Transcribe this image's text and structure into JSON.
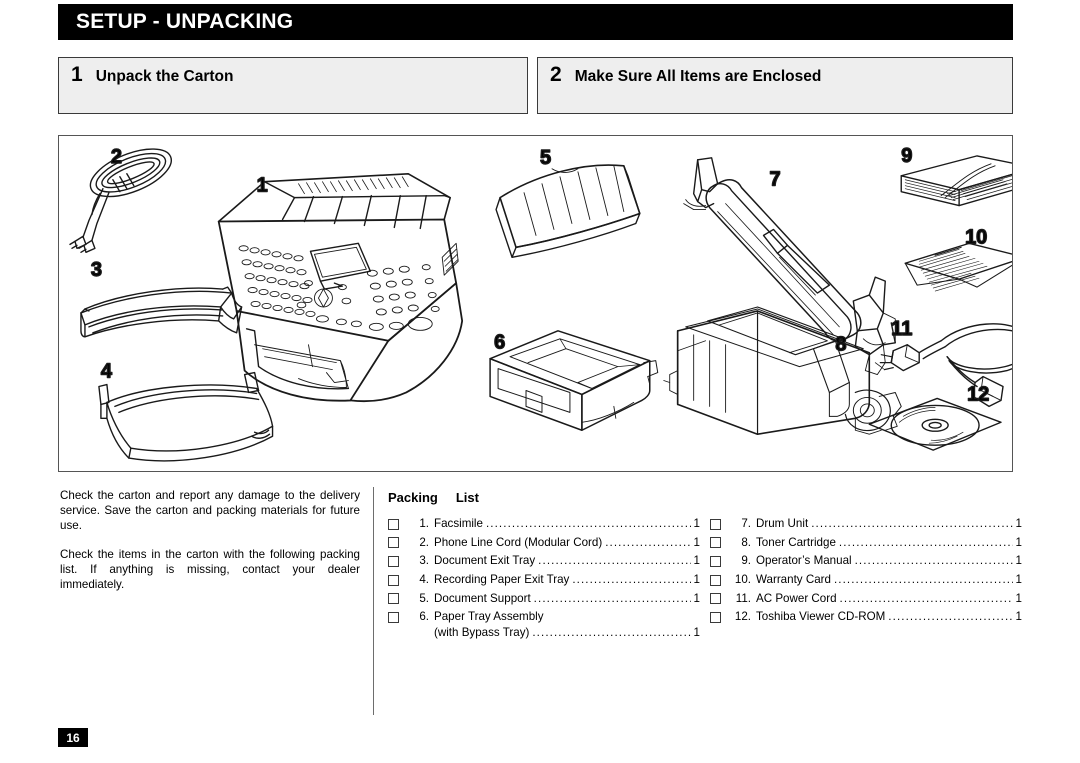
{
  "header": {
    "title": "SETUP - UNPACKING"
  },
  "steps": [
    {
      "number": "1",
      "label": "Unpack the Carton"
    },
    {
      "number": "2",
      "label": "Make Sure All Items are Enclosed"
    }
  ],
  "illustration": {
    "callouts": [
      {
        "id": "1",
        "label": "Facsimile"
      },
      {
        "id": "2",
        "label": "Phone Line Cord"
      },
      {
        "id": "3",
        "label": "Document Exit Tray"
      },
      {
        "id": "4",
        "label": "Recording Paper Exit Tray"
      },
      {
        "id": "5",
        "label": "Document Support"
      },
      {
        "id": "6",
        "label": "Paper Tray Assembly"
      },
      {
        "id": "7",
        "label": "Drum Unit"
      },
      {
        "id": "8",
        "label": "Toner Cartridge"
      },
      {
        "id": "9",
        "label": "Operator's Manual"
      },
      {
        "id": "10",
        "label": "Warranty Card"
      },
      {
        "id": "11",
        "label": "AC Power Cord"
      },
      {
        "id": "12",
        "label": "Toshiba Viewer CD-ROM"
      }
    ]
  },
  "instructions": {
    "paragraph1": "Check the carton and report any damage to the delivery service. Save the carton and packing materials for future use.",
    "paragraph2": "Check the items in the carton with the following packing list. If anything is missing, contact your dealer immediately."
  },
  "packing_list": {
    "title_word1": "Packing",
    "title_word2": "List",
    "left_column": [
      {
        "index": "1.",
        "name": "Facsimile",
        "qty": "1"
      },
      {
        "index": "2.",
        "name": "Phone Line Cord (Modular Cord)",
        "qty": "1"
      },
      {
        "index": "3.",
        "name": "Document Exit Tray",
        "qty": "1"
      },
      {
        "index": "4.",
        "name": "Recording Paper Exit Tray",
        "qty": "1"
      },
      {
        "index": "5.",
        "name": "Document Support",
        "qty": "1"
      },
      {
        "index": "6.",
        "name": "Paper Tray Assembly",
        "name2": "(with Bypass Tray)",
        "qty": "1"
      }
    ],
    "right_column": [
      {
        "index": "7.",
        "name": "Drum Unit",
        "qty": "1"
      },
      {
        "index": "8.",
        "name": "Toner Cartridge",
        "qty": "1"
      },
      {
        "index": "9.",
        "name": "Operator’s Manual",
        "qty": "1"
      },
      {
        "index": "10.",
        "name": "Warranty Card",
        "qty": "1"
      },
      {
        "index": "11.",
        "name": "AC Power Cord",
        "qty": "1"
      },
      {
        "index": "12.",
        "name": "Toshiba Viewer CD-ROM",
        "qty": "1"
      }
    ]
  },
  "footer": {
    "page_number": "16"
  },
  "colors": {
    "header_bg": "#000000",
    "header_text": "#ffffff",
    "step_box_bg": "#eeeeee",
    "step_box_border": "#3a3a3a",
    "illustration_border": "#555555",
    "page_bg": "#ffffff"
  }
}
